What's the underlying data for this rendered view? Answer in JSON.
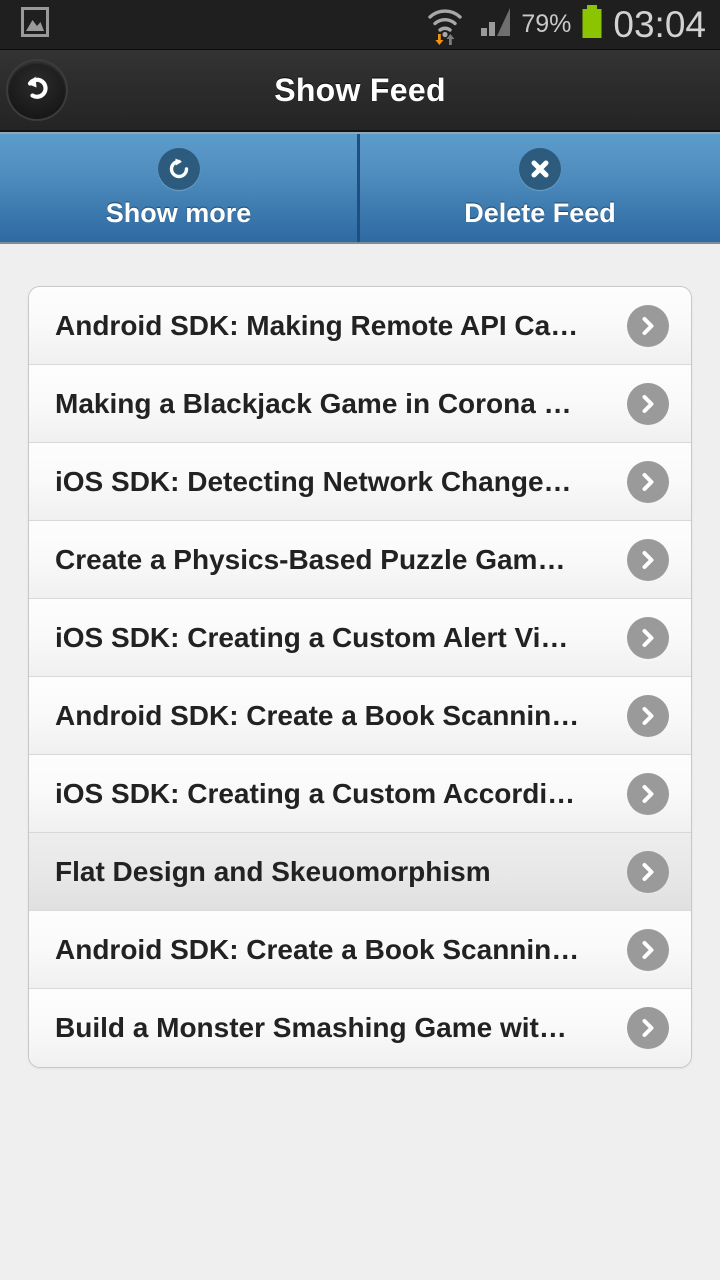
{
  "status_bar": {
    "notification_icon": "gallery-image-icon",
    "wifi_icon": "wifi-icon",
    "data_down_icon": "data-download-arrow-icon",
    "data_up_icon": "data-upload-arrow-icon",
    "signal_icon": "cellular-signal-icon",
    "battery_percent": "79%",
    "battery_icon": "battery-icon",
    "clock": "03:04",
    "battery_color": "#8bc400"
  },
  "title_bar": {
    "back_icon": "back-undo-arrow-icon",
    "title": "Show Feed"
  },
  "action_bar": {
    "accent_color": "#4a86bd",
    "buttons": [
      {
        "label": "Show more",
        "icon": "refresh-icon"
      },
      {
        "label": "Delete Feed",
        "icon": "close-x-icon"
      }
    ]
  },
  "feed": {
    "chevron_icon": "chevron-right-icon",
    "items": [
      {
        "title": "Android SDK: Making Remote API Ca…",
        "selected": false
      },
      {
        "title": "Making a Blackjack Game in Corona …",
        "selected": false
      },
      {
        "title": "iOS SDK: Detecting Network Change…",
        "selected": false
      },
      {
        "title": "Create a Physics-Based Puzzle Gam…",
        "selected": false
      },
      {
        "title": "iOS SDK: Creating a Custom Alert Vi…",
        "selected": false
      },
      {
        "title": "Android SDK: Create a Book Scannin…",
        "selected": false
      },
      {
        "title": "iOS SDK: Creating a Custom Accordi…",
        "selected": false
      },
      {
        "title": "Flat Design and Skeuomorphism",
        "selected": true
      },
      {
        "title": "Android SDK: Create a Book Scannin…",
        "selected": false
      },
      {
        "title": "Build a Monster Smashing Game wit…",
        "selected": false
      }
    ]
  }
}
